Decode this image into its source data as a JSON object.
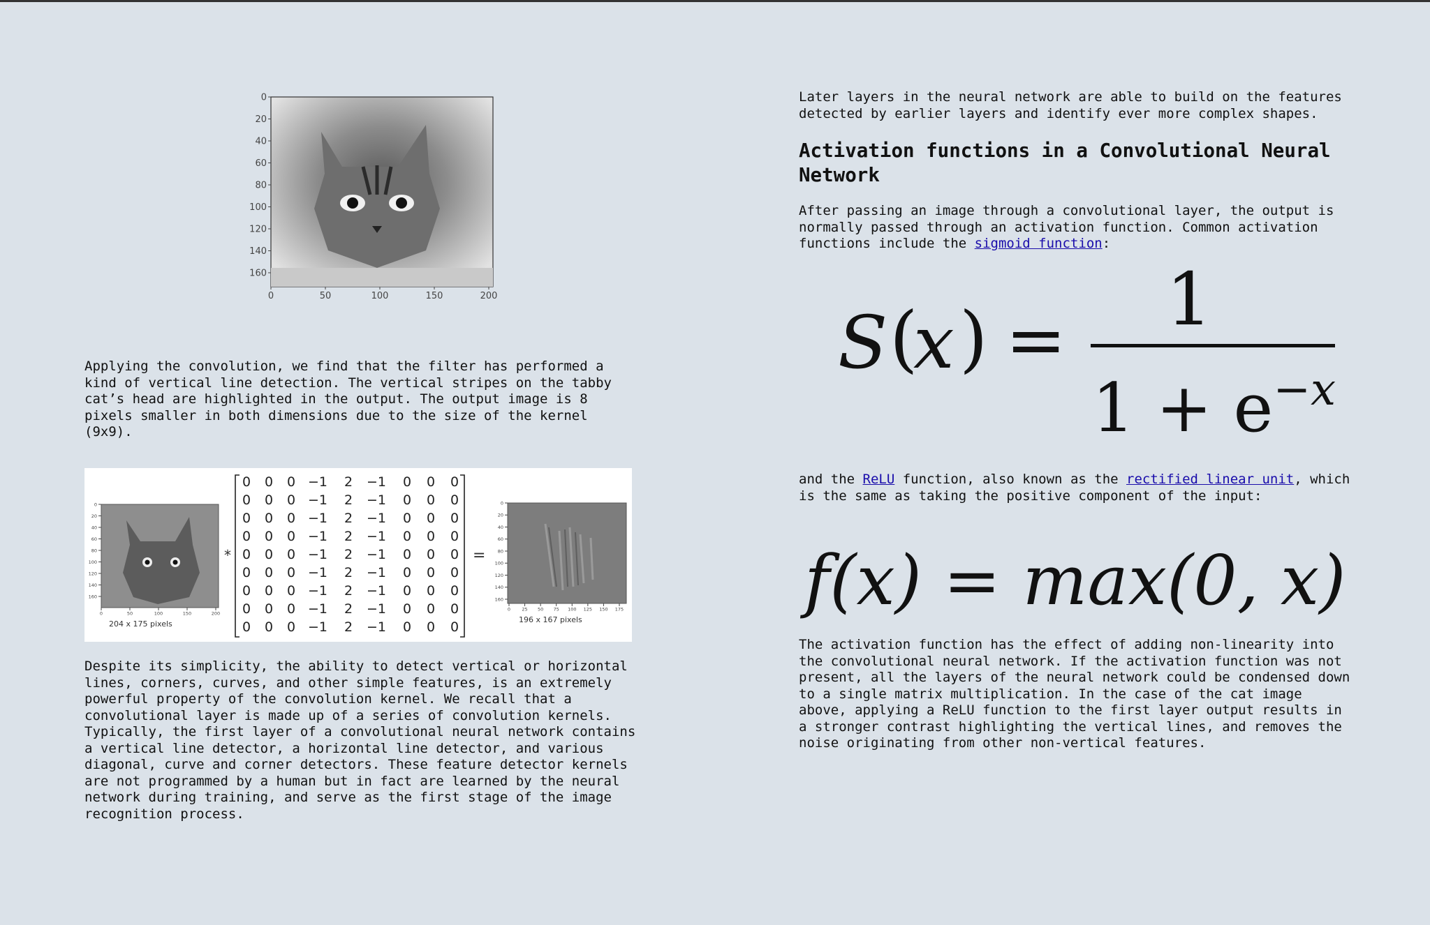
{
  "left": {
    "cat_plot": {
      "y_ticks": [
        "0",
        "20",
        "40",
        "60",
        "80",
        "100",
        "120",
        "140",
        "160"
      ],
      "x_ticks": [
        "0",
        "50",
        "100",
        "150",
        "200"
      ]
    },
    "para1": "Applying the convolution, we find that the filter has performed a kind of vertical line detection. The vertical stripes on the tabby cat’s head are highlighted in the output. The output image is 8 pixels smaller in both dimensions due to the size of the kernel (9x9).",
    "figure": {
      "input_caption": "204 x 175 pixels",
      "output_caption": "196 x 167 pixels",
      "input_y_ticks": [
        "0",
        "20",
        "40",
        "60",
        "80",
        "100",
        "120",
        "140",
        "160"
      ],
      "input_x_ticks": [
        "0",
        "50",
        "100",
        "150",
        "200"
      ],
      "output_y_ticks": [
        "0",
        "20",
        "40",
        "60",
        "80",
        "100",
        "120",
        "140",
        "160"
      ],
      "output_x_ticks": [
        "0",
        "25",
        "50",
        "75",
        "100",
        "125",
        "150",
        "175"
      ],
      "conv_op": "*",
      "equals_op": "=",
      "kernel_row": [
        "0",
        "0",
        "0",
        "−1",
        "2",
        "−1",
        "0",
        "0",
        "0"
      ]
    },
    "para2": "Despite its simplicity, the ability to detect vertical or horizontal lines, corners, curves, and other simple features, is an extremely powerful property of the convolution kernel. We recall that a convolutional layer is made up of a series of convolution kernels. Typically, the first layer of a convolutional neural network contains a vertical line detector, a horizontal line detector, and various diagonal, curve and corner detectors. These feature detector kernels are not programmed by a human but in fact are learned by the neural network during training, and serve as the first stage of the image recognition process."
  },
  "right": {
    "para_intro": "Later layers in the neural network are able to build on the features detected by earlier layers and identify ever more complex shapes.",
    "heading": "Activation functions in a Convolutional Neural Network",
    "para_sigmoid_before": "After passing an image through a convolutional layer, the output is normally passed through an activation function. Common activation functions include the ",
    "sigmoid_link": "sigmoid function",
    "para_sigmoid_after": ":",
    "sigmoid_formula": {
      "lhs_S": "S",
      "lhs_open": "(",
      "lhs_x": "x",
      "lhs_close": ")",
      "equals": "=",
      "numerator": "1",
      "denominator_base": "1 + e",
      "denominator_exp": "−x"
    },
    "relu_text_1": "and the ",
    "relu_link": "ReLU",
    "relu_text_2": " function, also known as the ",
    "relu_link_2": "rectified linear unit",
    "relu_text_3": ", which is the same as taking the positive component of the input:",
    "relu_formula": "f(x) = max(0, x)",
    "para_final": "The activation function has the effect of adding non-linearity into the convolutional neural network. If the activation function was not present, all the layers of the neural network could be condensed down to a single matrix multiplication. In the case of the cat image above, applying a ReLU function to the first layer output results in a stronger contrast highlighting the vertical lines, and removes the noise originating from other non-vertical features."
  }
}
